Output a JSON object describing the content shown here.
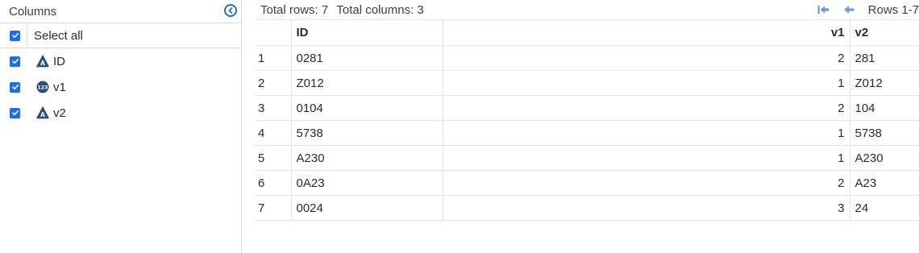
{
  "columns_panel": {
    "title": "Columns",
    "select_all": {
      "label": "Select all",
      "checked": true
    },
    "columns": [
      {
        "name": "ID",
        "type_icon": "character-type-icon",
        "checked": true
      },
      {
        "name": "v1",
        "type_icon": "numeric-type-icon",
        "checked": true
      },
      {
        "name": "v2",
        "type_icon": "character-type-icon",
        "checked": true
      }
    ]
  },
  "table": {
    "summary": {
      "rows": "Total rows: 7",
      "columns": "Total columns: 3"
    },
    "pager": {
      "range": "Rows 1-7"
    },
    "headers": {
      "index": "",
      "id": "ID",
      "v1": "v1",
      "v2": "v2"
    },
    "rows": [
      {
        "index": "1",
        "id": "0281",
        "v1": "2",
        "v2": "281"
      },
      {
        "index": "2",
        "id": "Z012",
        "v1": "1",
        "v2": "Z012"
      },
      {
        "index": "3",
        "id": "0104",
        "v1": "2",
        "v2": "104"
      },
      {
        "index": "4",
        "id": "5738",
        "v1": "1",
        "v2": "5738"
      },
      {
        "index": "5",
        "id": "A230",
        "v1": "1",
        "v2": "A230"
      },
      {
        "index": "6",
        "id": "0A23",
        "v1": "2",
        "v2": "A23"
      },
      {
        "index": "7",
        "id": "0024",
        "v1": "3",
        "v2": "24"
      }
    ]
  },
  "colors": {
    "checkbox": "#1f6fe0",
    "type_icon": "#2c4f73",
    "accent": "#2d6fb5",
    "pager_icon": "#6f9fd1"
  }
}
